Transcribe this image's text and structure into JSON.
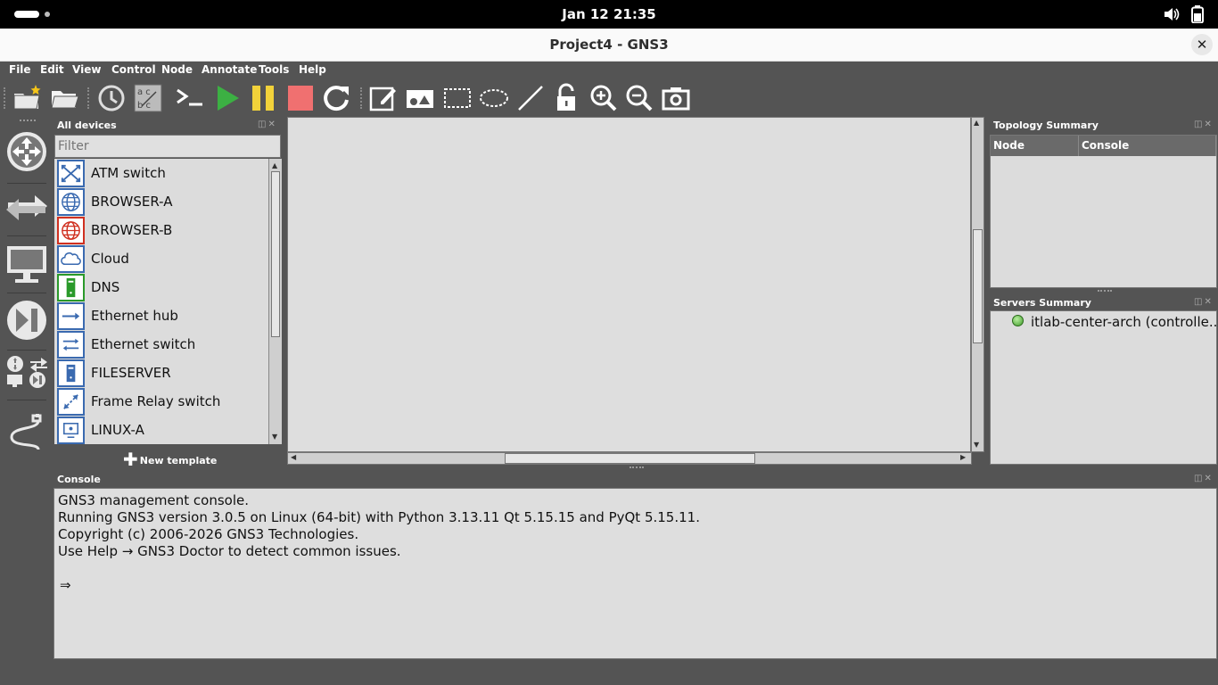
{
  "topbar": {
    "clock": "Jan 12  21:35"
  },
  "window": {
    "title": "Project4 - GNS3",
    "close_glyph": "✕"
  },
  "menu": [
    "File",
    "Edit",
    "View",
    "Control",
    "Node",
    "Annotate",
    "Tools",
    "Help"
  ],
  "toolbar": {
    "icons": [
      "new-project-icon",
      "open-project-icon",
      "snapshot-icon",
      "show-interface-labels-icon",
      "console-all-icon",
      "start-all-icon",
      "suspend-all-icon",
      "stop-all-icon",
      "reload-all-icon",
      "add-note-icon",
      "insert-picture-icon",
      "draw-rectangle-icon",
      "draw-ellipse-icon",
      "draw-line-icon",
      "lock-items-icon",
      "zoom-in-icon",
      "zoom-out-icon",
      "screenshot-icon"
    ]
  },
  "devices_panel": {
    "title": "All devices",
    "filter_placeholder": "Filter",
    "items": [
      {
        "label": "ATM switch",
        "icon": "atm-switch-icon",
        "color": "#3a6ab0"
      },
      {
        "label": "BROWSER-A",
        "icon": "globe-icon",
        "color": "#3a6ab0"
      },
      {
        "label": "BROWSER-B",
        "icon": "globe-icon",
        "color": "#d03020"
      },
      {
        "label": "Cloud",
        "icon": "cloud-icon",
        "color": "#3a6ab0"
      },
      {
        "label": "DNS",
        "icon": "server-icon",
        "color": "#2a9a2a"
      },
      {
        "label": "Ethernet hub",
        "icon": "hub-icon",
        "color": "#3a6ab0"
      },
      {
        "label": "Ethernet switch",
        "icon": "switch-icon",
        "color": "#3a6ab0"
      },
      {
        "label": "FILESERVER",
        "icon": "server-icon",
        "color": "#3a6ab0"
      },
      {
        "label": "Frame Relay switch",
        "icon": "frame-relay-icon",
        "color": "#3a6ab0"
      },
      {
        "label": "LINUX-A",
        "icon": "computer-icon",
        "color": "#3a6ab0"
      }
    ],
    "new_template": "New template"
  },
  "topology_summary": {
    "title": "Topology Summary",
    "col_node": "Node",
    "col_console": "Console"
  },
  "servers_summary": {
    "title": "Servers Summary",
    "server": "itlab-center-arch (controlle...",
    "status_color": "#3f9a2a"
  },
  "console": {
    "title": "Console",
    "lines": [
      "GNS3 management console.",
      "Running GNS3 version 3.0.5 on Linux (64-bit) with Python 3.13.11 Qt 5.15.15 and PyQt 5.15.11.",
      "Copyright (c) 2006-2026 GNS3 Technologies.",
      "Use Help → GNS3 Doctor to detect common issues.",
      "",
      "⇒"
    ]
  },
  "colors": {
    "background": "#545454",
    "canvas": "#dedede",
    "start": "#3cb043",
    "suspend": "#f2d23a",
    "stop": "#f07070"
  }
}
